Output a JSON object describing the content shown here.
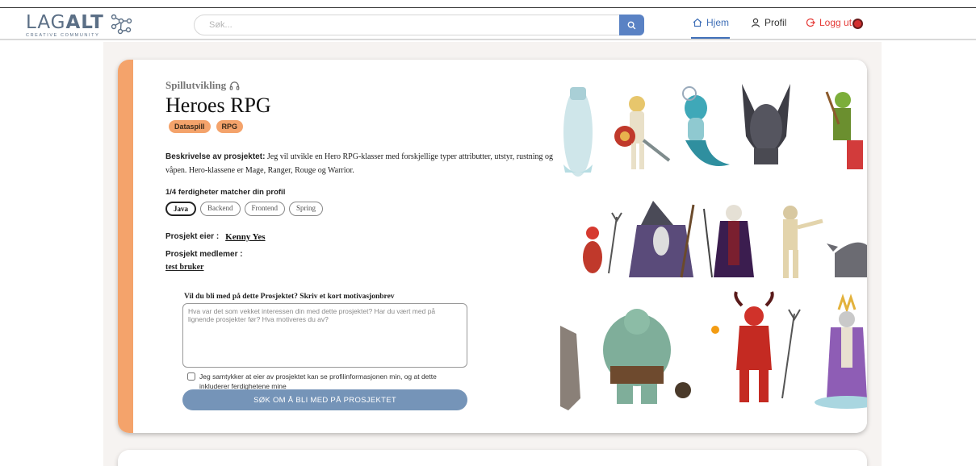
{
  "header": {
    "logo_word_light": "LAG",
    "logo_word_bold": "ALT",
    "logo_subtitle": "CREATIVE COMMUNITY",
    "search_placeholder": "Søk...",
    "nav": {
      "home": "Hjem",
      "profile": "Profil",
      "logout": "Logg ut"
    },
    "icons": [
      "home-icon",
      "user-icon",
      "logout-icon",
      "search-icon",
      "notification-dot"
    ]
  },
  "project": {
    "category": "Spillutvikling",
    "title": "Heroes RPG",
    "tags": [
      "Dataspill",
      "RPG"
    ],
    "description_label": "Beskrivelse av prosjektet:",
    "description": " Jeg vil utvikle en Hero RPG-klasser med forskjellige typer attributter, utstyr, rustning og våpen. Hero-klassene er Mage, Ranger, Rouge og Warrior.",
    "skills_match": "1/4 ferdigheter matcher din profil",
    "skills": [
      {
        "name": "Java",
        "matched": true
      },
      {
        "name": "Backend",
        "matched": false
      },
      {
        "name": "Frontend",
        "matched": false
      },
      {
        "name": "Spring",
        "matched": false
      }
    ],
    "owner_label": "Prosjekt eier :",
    "owner_name": "Kenny Yes",
    "members_label": "Prosjekt medlemer :",
    "members": [
      "test bruker"
    ]
  },
  "application": {
    "heading": "Vil du bli med på dette Prosjektet? Skriv et kort motivasjonbrev",
    "placeholder": "Hva var det som vekket interessen din med dette prosjektet? Har du vært med på lignende prosjekter før? Hva motiveres du av?",
    "consent": "Jeg samtykker at eier av prosjektet kan se profilinformasjonen min, og at dette inkluderer ferdighetene mine",
    "submit": "SØK OM Å BLI MED PÅ PROSJEKTET"
  },
  "colors": {
    "accent_orange": "#f4a36b",
    "nav_blue": "#3f6fb7",
    "logout_red": "#e53935",
    "button_blue": "#7594b8"
  }
}
